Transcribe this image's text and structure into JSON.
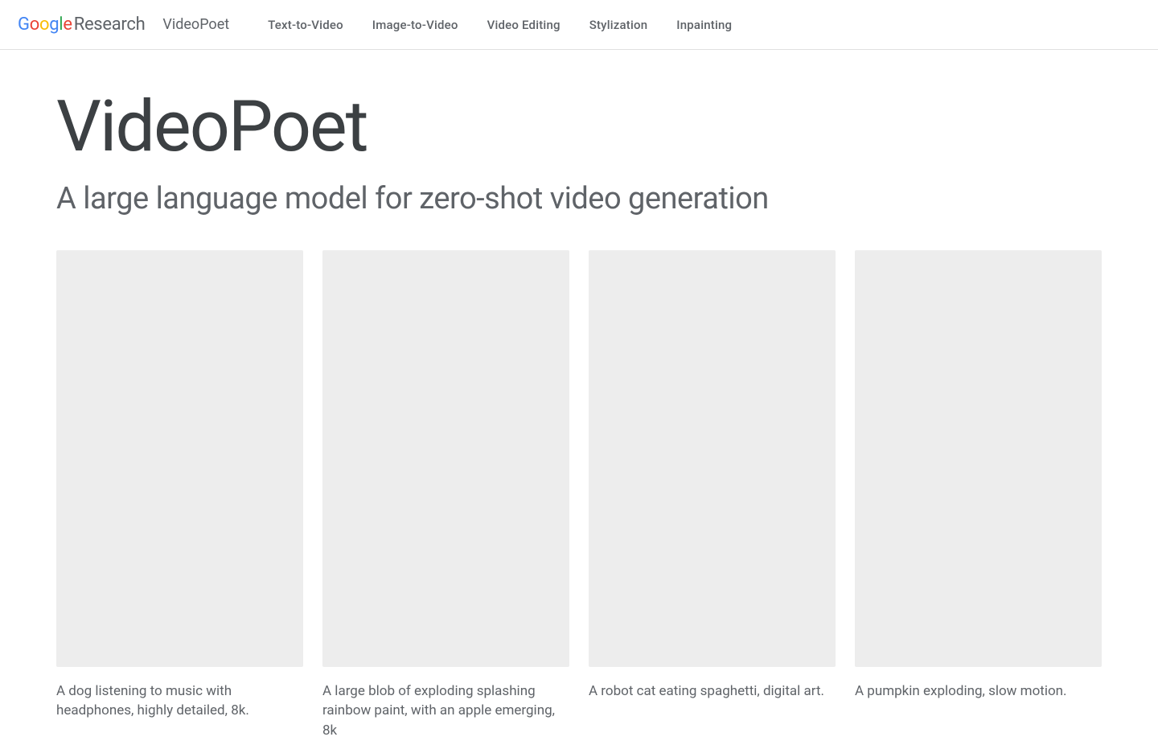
{
  "header": {
    "logo_research": "Research",
    "product": "VideoPoet",
    "nav": [
      "Text-to-Video",
      "Image-to-Video",
      "Video Editing",
      "Stylization",
      "Inpainting"
    ]
  },
  "main": {
    "title": "VideoPoet",
    "subtitle": "A large language model for zero-shot video generation",
    "cards": [
      {
        "caption": "A dog listening to music with headphones, highly detailed, 8k."
      },
      {
        "caption": "A large blob of exploding splashing rainbow paint, with an apple emerging, 8k"
      },
      {
        "caption": "A robot cat eating spaghetti, digital art."
      },
      {
        "caption": "A pumpkin exploding, slow motion."
      }
    ]
  }
}
